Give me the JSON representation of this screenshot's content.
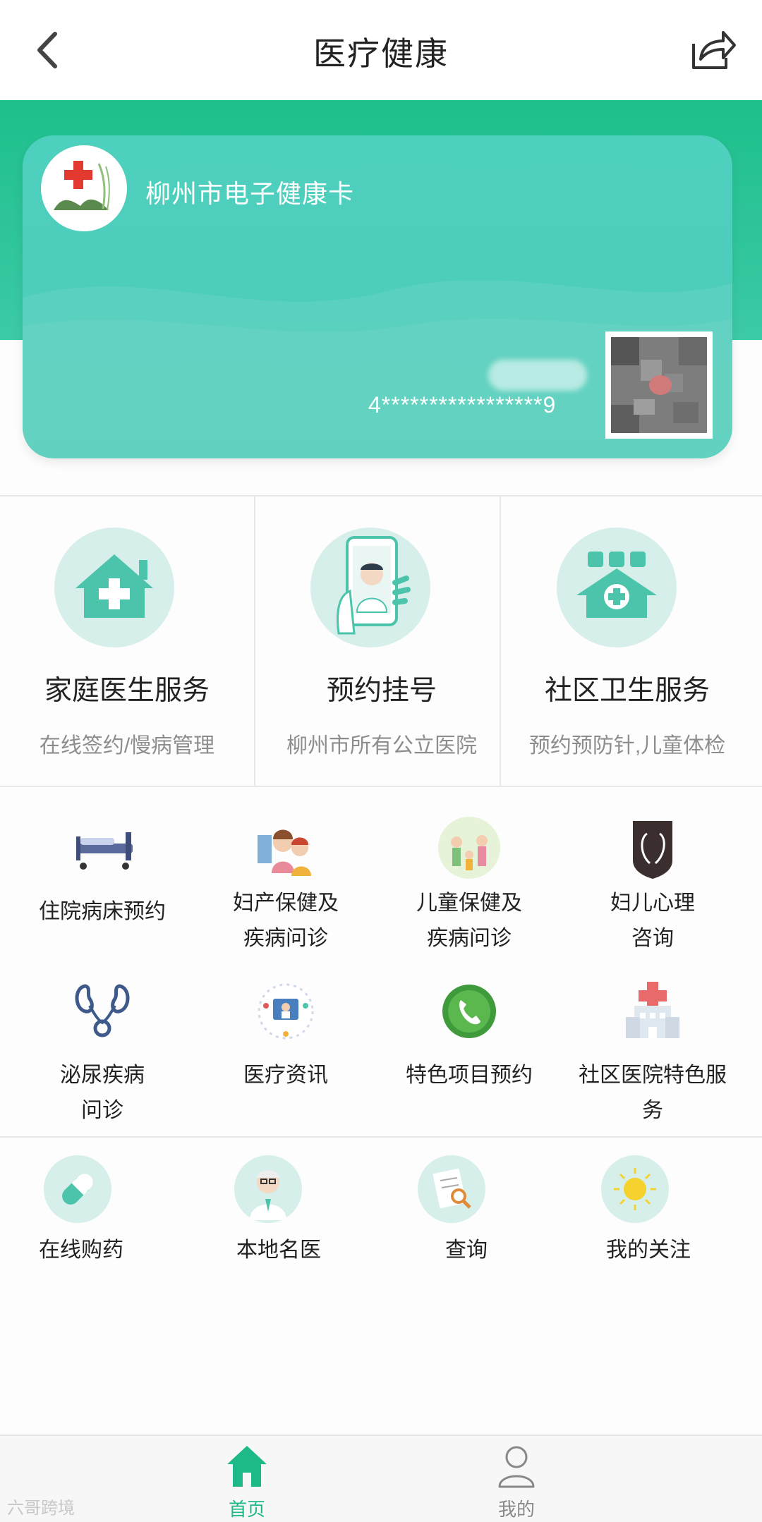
{
  "header": {
    "title": "医疗健康",
    "back_icon": "chevron-left-icon",
    "share_icon": "share-icon"
  },
  "card": {
    "title": "柳州市电子健康卡",
    "number": "4*****************9"
  },
  "services": [
    {
      "title": "家庭医生服务",
      "subtitle": "在线签约/慢病管理",
      "icon": "house-cross-icon"
    },
    {
      "title": "预约挂号",
      "subtitle": "柳州市所有公立医院",
      "icon": "phone-doctor-icon"
    },
    {
      "title": "社区卫生服务",
      "subtitle": "预约预防针,儿童体检",
      "icon": "community-clinic-icon"
    }
  ],
  "grid": [
    {
      "label": "住院病床预约",
      "icon": "hospital-bed-icon"
    },
    {
      "label": "妇产保健及疾病问诊",
      "icon": "mother-child-icon"
    },
    {
      "label": "儿童保健及疾病问诊",
      "icon": "child-health-icon"
    },
    {
      "label": "妇儿心理咨询",
      "icon": "psychology-icon"
    },
    {
      "label": "泌尿疾病问诊",
      "icon": "kidney-icon"
    },
    {
      "label": "医疗资讯",
      "icon": "medical-news-icon"
    },
    {
      "label": "特色项目预约",
      "icon": "phone-call-icon"
    },
    {
      "label": "社区医院特色服务",
      "icon": "hospital-building-icon"
    }
  ],
  "bottom_row": [
    {
      "label": "在线购药",
      "icon": "pill-icon"
    },
    {
      "label": "本地名医",
      "icon": "doctor-icon"
    },
    {
      "label": "查询",
      "icon": "search-document-icon"
    },
    {
      "label": "我的关注",
      "icon": "sun-icon"
    }
  ],
  "tabbar": {
    "home": "首页",
    "mine": "我的",
    "active_color": "#1eb989"
  },
  "watermark": "六哥跨境",
  "colors": {
    "brand_green": "#1ebf8c",
    "card_teal": "#4ed0bf",
    "circle_bg": "#d6efea"
  }
}
